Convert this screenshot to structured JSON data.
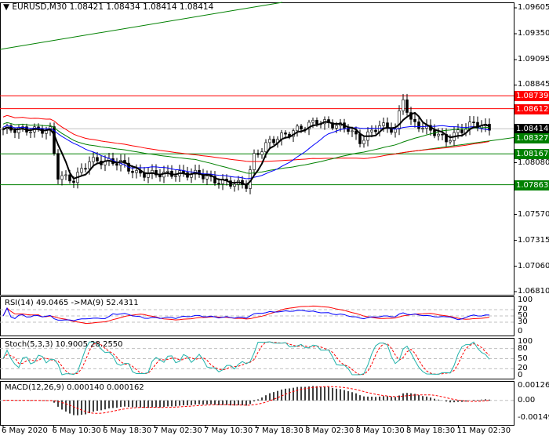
{
  "header": {
    "symbol": "EURUSD,M30",
    "ohlc": "1.08421 1.08434 1.08414 1.08414"
  },
  "price_axis": [
    "1.09605",
    "1.09350",
    "1.09095",
    "1.08845",
    "1.08080",
    "1.07825",
    "1.07570",
    "1.07315",
    "1.07060",
    "1.06810"
  ],
  "levels": [
    {
      "price": "1.08739",
      "color": "#ff0000"
    },
    {
      "price": "1.08612",
      "color": "#ff0000"
    },
    {
      "price": "1.08414",
      "color": "#000000"
    },
    {
      "price": "1.08327",
      "color": "#008000"
    },
    {
      "price": "1.08167",
      "color": "#008000"
    },
    {
      "price": "1.07863",
      "color": "#008000"
    }
  ],
  "time_axis": [
    "6 May 2020",
    "6 May 10:30",
    "6 May 18:30",
    "7 May 02:30",
    "7 May 10:30",
    "7 May 18:30",
    "8 May 02:30",
    "8 May 10:30",
    "8 May 18:30",
    "11 May 02:30"
  ],
  "rsi": {
    "label": "RSI(14) 49.0465  ->MA(9) 52.4311",
    "axis": [
      "100",
      "70",
      "50",
      "30",
      "0"
    ]
  },
  "stoch": {
    "label": "Stoch(5,3,3) 10.9005 28.2550",
    "axis": [
      "100",
      "80",
      "50",
      "20",
      "0"
    ]
  },
  "macd": {
    "label": "MACD(12,26,9) 0.000140 0.000162",
    "axis": [
      "0.001261",
      "0.00",
      "-0.001491"
    ]
  },
  "chart_data": {
    "type": "candlestick",
    "candles": 125,
    "price_path": [
      [
        0,
        1.0841
      ],
      [
        12,
        1.084
      ],
      [
        14,
        1.0795
      ],
      [
        18,
        1.0791
      ],
      [
        22,
        1.081
      ],
      [
        30,
        1.0808
      ],
      [
        34,
        1.0797
      ],
      [
        50,
        1.0797
      ],
      [
        54,
        1.079
      ],
      [
        62,
        1.0786
      ],
      [
        64,
        1.0814
      ],
      [
        68,
        1.0829
      ],
      [
        80,
        1.0849
      ],
      [
        88,
        1.0842
      ],
      [
        91,
        1.0829
      ],
      [
        96,
        1.0845
      ],
      [
        100,
        1.084
      ],
      [
        102,
        1.0872
      ],
      [
        104,
        1.0848
      ],
      [
        110,
        1.0838
      ],
      [
        113,
        1.083
      ],
      [
        116,
        1.0838
      ],
      [
        120,
        1.0847
      ],
      [
        124,
        1.0841
      ]
    ]
  }
}
